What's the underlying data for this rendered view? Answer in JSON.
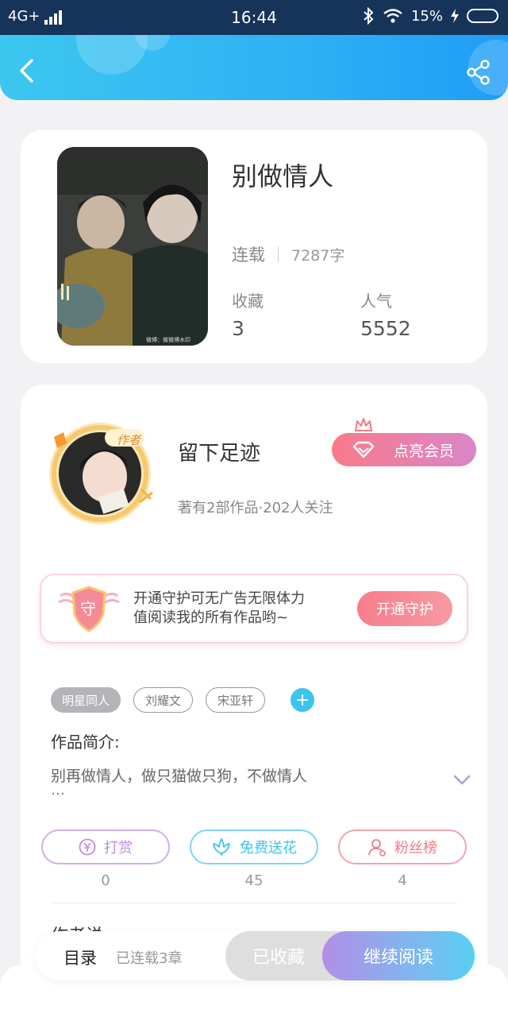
{
  "status_bar": {
    "network": "4G+",
    "time": "16:44",
    "battery": "15%"
  },
  "book": {
    "title": "别做情人",
    "status": "连载",
    "word_count": "7287字",
    "favorites_label": "收藏",
    "favorites_value": "3",
    "popularity_label": "人气",
    "popularity_value": "5552",
    "cover_caption": "微博：做微博水印"
  },
  "author": {
    "badge": "作者",
    "name": "留下足迹",
    "info": "著有2部作品·202人关注",
    "vip_button": "点亮会员"
  },
  "guard": {
    "icon_char": "守",
    "text_line1": "开通守护可无广告无限体力",
    "text_line2": "值阅读我的所有作品哟~",
    "button": "开通守护"
  },
  "tags": [
    "明星同人",
    "刘耀文",
    "宋亚轩"
  ],
  "tag_add": "+",
  "intro": {
    "title": "作品简介:",
    "text": "别再做情人，做只猫做只狗，不做情人",
    "ellipsis": "…"
  },
  "actions": [
    {
      "label": "打赏",
      "count": "0",
      "color": "#c08be0"
    },
    {
      "label": "免费送花",
      "count": "45",
      "color": "#3cc4ef"
    },
    {
      "label": "粉丝榜",
      "count": "4",
      "color": "#f07b86"
    }
  ],
  "peek_text": "作者说",
  "bottom": {
    "toc": "目录",
    "toc_sub": "已连载3章",
    "collected": "已收藏",
    "continue": "继续阅读"
  },
  "colors": {
    "header": "#2fb3f4",
    "accent_pink": "#f77c8c",
    "accent_blue": "#3cc4ef",
    "accent_purple": "#c08be0"
  }
}
